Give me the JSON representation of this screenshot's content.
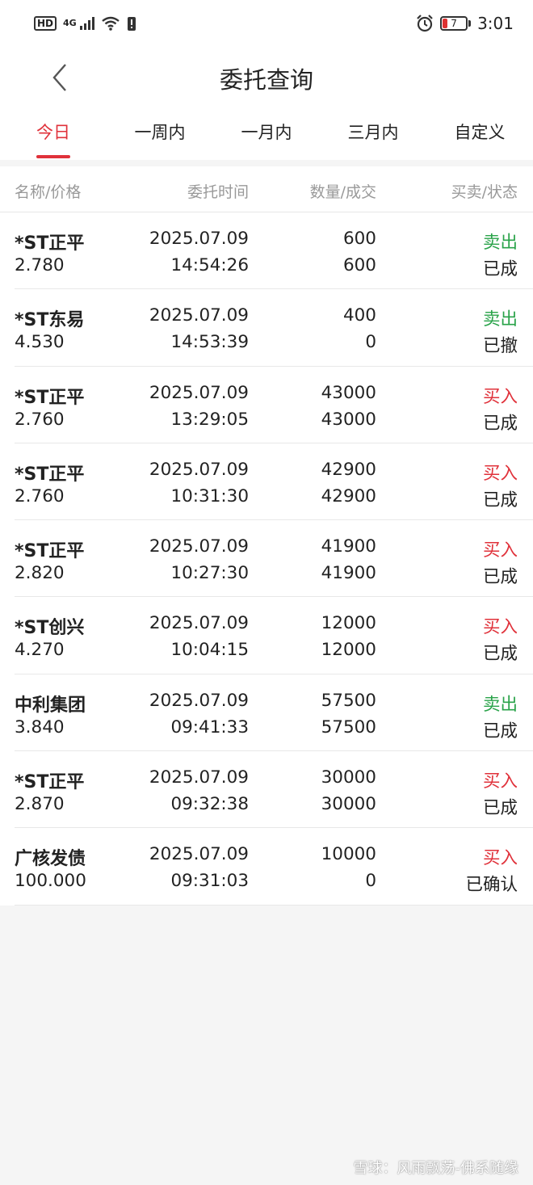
{
  "status": {
    "hd": "HD",
    "signal": "4G",
    "battery": "7",
    "time": "3:01"
  },
  "header": {
    "title": "委托查询",
    "tabs": [
      "今日",
      "一周内",
      "一月内",
      "三月内",
      "自定义"
    ],
    "active_tab": "今日"
  },
  "columns": {
    "name_price": "名称/价格",
    "time": "委托时间",
    "qty": "数量/成交",
    "side_status": "买卖/状态"
  },
  "colors": {
    "accent": "#e0313a",
    "buy": "#e0313a",
    "sell": "#2aa34a"
  },
  "orders": [
    {
      "name": "*ST正平",
      "price": "2.780",
      "date": "2025.07.09",
      "time": "14:54:26",
      "qty": "600",
      "filled": "600",
      "side": "卖出",
      "side_type": "sell",
      "status": "已成"
    },
    {
      "name": "*ST东易",
      "price": "4.530",
      "date": "2025.07.09",
      "time": "14:53:39",
      "qty": "400",
      "filled": "0",
      "side": "卖出",
      "side_type": "sell",
      "status": "已撤"
    },
    {
      "name": "*ST正平",
      "price": "2.760",
      "date": "2025.07.09",
      "time": "13:29:05",
      "qty": "43000",
      "filled": "43000",
      "side": "买入",
      "side_type": "buy",
      "status": "已成"
    },
    {
      "name": "*ST正平",
      "price": "2.760",
      "date": "2025.07.09",
      "time": "10:31:30",
      "qty": "42900",
      "filled": "42900",
      "side": "买入",
      "side_type": "buy",
      "status": "已成"
    },
    {
      "name": "*ST正平",
      "price": "2.820",
      "date": "2025.07.09",
      "time": "10:27:30",
      "qty": "41900",
      "filled": "41900",
      "side": "买入",
      "side_type": "buy",
      "status": "已成"
    },
    {
      "name": "*ST创兴",
      "price": "4.270",
      "date": "2025.07.09",
      "time": "10:04:15",
      "qty": "12000",
      "filled": "12000",
      "side": "买入",
      "side_type": "buy",
      "status": "已成"
    },
    {
      "name": "中利集团",
      "price": "3.840",
      "date": "2025.07.09",
      "time": "09:41:33",
      "qty": "57500",
      "filled": "57500",
      "side": "卖出",
      "side_type": "sell",
      "status": "已成"
    },
    {
      "name": "*ST正平",
      "price": "2.870",
      "date": "2025.07.09",
      "time": "09:32:38",
      "qty": "30000",
      "filled": "30000",
      "side": "买入",
      "side_type": "buy",
      "status": "已成"
    },
    {
      "name": "广核发债",
      "price": "100.000",
      "date": "2025.07.09",
      "time": "09:31:03",
      "qty": "10000",
      "filled": "0",
      "side": "买入",
      "side_type": "buy",
      "status": "已确认"
    }
  ],
  "watermark": "雪球：风雨飘荡-佛系随缘"
}
